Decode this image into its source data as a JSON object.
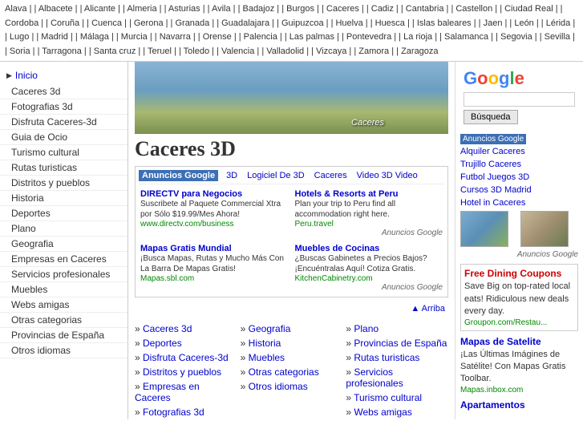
{
  "topnav": {
    "items": [
      "Alava",
      "Albacete",
      "Alicante",
      "Almeria",
      "Asturias",
      "Avila",
      "Badajoz",
      "Burgos",
      "Caceres",
      "Cadiz",
      "Cantabria",
      "Castellon",
      "Ciudad Real",
      "Cordoba",
      "Coruña",
      "Cuenca",
      "Gerona",
      "Granada",
      "Guadalajara",
      "Guipuzcoa",
      "Huelva",
      "Huesca",
      "Islas baleares",
      "Jaen",
      "León",
      "Lérida",
      "Lugo",
      "Madrid",
      "Málaga",
      "Murcia",
      "Navarra",
      "Orense",
      "Palencia",
      "Las palmas",
      "Pontevedra",
      "La rioja",
      "Salamanca",
      "Segovia",
      "Sevilla",
      "Soria",
      "Tarragona",
      "Santa cruz",
      "Teruel",
      "Toledo",
      "Valencia",
      "Valladolid",
      "Vizcaya",
      "Zamora",
      "Zaragoza"
    ]
  },
  "sidebar": {
    "inicio": "Inicio",
    "items": [
      "Caceres 3d",
      "Fotografias 3d",
      "Disfruta Caceres-3d",
      "Guia de Ocio",
      "Turismo cultural",
      "Rutas turisticas",
      "Distritos y pueblos",
      "Historia",
      "Deportes",
      "Plano",
      "Geografia",
      "Empresas en Caceres",
      "Servicios profesionales",
      "Muebles",
      "Webs amigas",
      "Otras categorias",
      "Provincias de España",
      "Otros idiomas"
    ]
  },
  "hero": {
    "label": "Caceres"
  },
  "main": {
    "title": "Caceres 3D",
    "ads_header_label": "Anuncios Google",
    "ads_links": [
      "3D",
      "Logiciel De 3D",
      "Caceres",
      "Video 3D Video"
    ],
    "ad1_title": "DIRECTV para Negocios",
    "ad1_desc": "Suscribete al Paquete Commercial Xtra por Sólo $19.99/Mes Ahora!",
    "ad1_url": "www.directv.com/business",
    "ad2_title": "Hotels & Resorts at Peru",
    "ad2_desc": "Plan your trip to Peru find all accommodation right here.",
    "ad2_url": "Peru.travel",
    "ad3_title": "Mapas Gratis Mundial",
    "ad3_desc": "¡Busca Mapas, Rutas y Mucho Más Con La Barra De Mapas Gratis!",
    "ad3_url": "Mapas.sbl.com",
    "ad4_title": "Muebles de Cocinas",
    "ad4_desc": "¿Buscas Gabinetes a Precios Bajos? ¡Encuéntralas Aquí! Cotiza Gratis.",
    "ad4_url": "KitchenCabinetry.com",
    "arriba": "▲ Arriba",
    "bottom_links_col1": [
      "Caceres 3d",
      "Deportes",
      "Disfruta Caceres-3d",
      "Distritos y pueblos",
      "Empresas en Caceres",
      "Fotografias 3d"
    ],
    "bottom_links_col2": [
      "Geografia",
      "Historia",
      "Muebles",
      "Otras categorias",
      "Otros idiomas"
    ],
    "bottom_links_col3": [
      "Plano",
      "Provincias de España",
      "Rutas turisticas",
      "Servicios profesionales",
      "Turismo cultural",
      "Webs amigas"
    ]
  },
  "right": {
    "google_label": "Google",
    "search_placeholder": "",
    "search_btn": "Búsqueda",
    "ads_label": "Anuncios Google",
    "right_ads": [
      "Alquiler Caceres",
      "Trujillo Caceres",
      "Futbol Juegos 3D",
      "Cursos 3D Madrid",
      "Hotel in Caceres"
    ],
    "promo_title": "Free Dining Coupons",
    "promo_text": "Save Big on top-rated local eats! Ridiculous new deals every day.",
    "promo_url": "Groupon.com/Restau...",
    "map_title": "Mapas de Satelite",
    "map_text": "¡Las Últimas Imágines de Satélite! Con Mapas Gratis Toolbar.",
    "map_url": "Mapas.inbox.com",
    "apartments_title": "Apartamentos"
  }
}
